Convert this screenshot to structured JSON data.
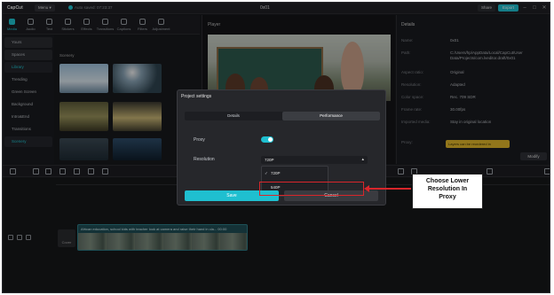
{
  "titlebar": {
    "logo": "CapCut",
    "menu_label": "Menu ▾",
    "autosave": "Auto saved: 07:23:37",
    "project_title": "0x01",
    "share_label": "Share",
    "export_label": "Export"
  },
  "toolbar": {
    "items": [
      {
        "label": "Media",
        "icon": "media-icon",
        "active": true
      },
      {
        "label": "Audio",
        "icon": "audio-icon"
      },
      {
        "label": "Text",
        "icon": "text-icon"
      },
      {
        "label": "Stickers",
        "icon": "stickers-icon"
      },
      {
        "label": "Effects",
        "icon": "effects-icon"
      },
      {
        "label": "Transitions",
        "icon": "transitions-icon"
      },
      {
        "label": "Captions",
        "icon": "captions-icon"
      },
      {
        "label": "Filters",
        "icon": "filters-icon"
      },
      {
        "label": "Adjustment",
        "icon": "adjustment-icon"
      }
    ]
  },
  "sidenav": {
    "items": [
      "Yours",
      "Spaces",
      "Library",
      "Trending",
      "Green Screen",
      "Background",
      "Intro&End",
      "Transitions",
      "Scenery"
    ]
  },
  "media": {
    "section_label": "Scenery"
  },
  "player": {
    "label": "Player"
  },
  "details": {
    "header": "Details",
    "rows": [
      {
        "label": "Name:",
        "value": "0x01"
      },
      {
        "label": "Path:",
        "value": "C:/Users/hp/AppData/Local/CapCut/User Data/Projects/com.lveditor.draft/0x01"
      },
      {
        "label": "Aspect ratio:",
        "value": "Original"
      },
      {
        "label": "Resolution:",
        "value": "Adapted"
      },
      {
        "label": "Color space:",
        "value": "Rec. 709 SDR"
      },
      {
        "label": "Frame rate:",
        "value": "30.00fps"
      },
      {
        "label": "Imported media:",
        "value": "Stay in original location"
      },
      {
        "label": "Proxy:",
        "value": "On"
      }
    ],
    "notice": "Layers can be reordered in",
    "modify_label": "Modify"
  },
  "timeline": {
    "cover_label": "Cover",
    "clip_title": "African education, school kids with teacher look at camera and raise their hand in cla... 00:00"
  },
  "modal": {
    "title": "Project settings",
    "tabs": [
      {
        "label": "Details",
        "active": false
      },
      {
        "label": "Performance",
        "active": true
      }
    ],
    "proxy_label": "Proxy",
    "proxy_on": true,
    "resolution_label": "Resolution",
    "resolution_value": "720P",
    "options": [
      {
        "label": "720P",
        "selected": true
      },
      {
        "label": "540P",
        "selected": false
      }
    ],
    "save_label": "Save",
    "cancel_label": "Cancel"
  },
  "annotation": {
    "callout_lines": [
      "Choose Lower",
      "Resolution In",
      "Proxy"
    ],
    "color": "#d8262b"
  }
}
